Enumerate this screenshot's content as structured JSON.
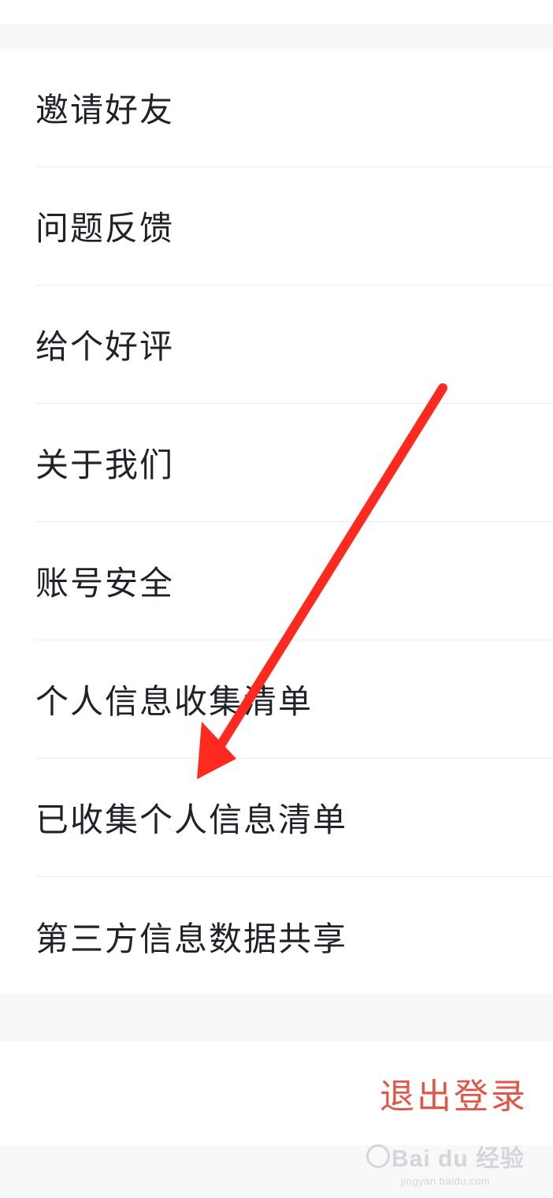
{
  "menu": {
    "items": [
      {
        "label": "邀请好友"
      },
      {
        "label": "问题反馈"
      },
      {
        "label": "给个好评"
      },
      {
        "label": "关于我们"
      },
      {
        "label": "账号安全"
      },
      {
        "label": "个人信息收集清单"
      },
      {
        "label": "已收集个人信息清单"
      },
      {
        "label": "第三方信息数据共享"
      }
    ]
  },
  "logout": {
    "label": "退出登录"
  },
  "colors": {
    "accent_red": "#e0574a",
    "annotation_arrow": "#ff2a1f",
    "text": "#1f2329",
    "background": "#f7f8fa"
  },
  "watermark": {
    "brand": "Bai du 经验",
    "url": "jingyan.baidu.com"
  }
}
